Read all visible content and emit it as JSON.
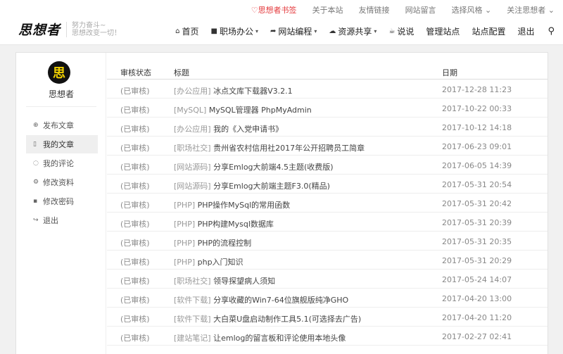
{
  "topbar": [
    {
      "label": "思想者书签",
      "icon": "heart-icon",
      "highlight": true
    },
    {
      "label": "关于本站"
    },
    {
      "label": "友情链接"
    },
    {
      "label": "网站留言"
    },
    {
      "label": "选择风格",
      "dropdown": true
    },
    {
      "label": "关注思想者",
      "dropdown": true
    }
  ],
  "logo": {
    "text": "思想者",
    "slogan1": "努力奋斗~",
    "slogan2": "思想改变一切！"
  },
  "nav": [
    {
      "label": "首页",
      "icon": "home-icon"
    },
    {
      "label": "职场办公",
      "icon": "briefcase-icon",
      "dropdown": true
    },
    {
      "label": "网站编程",
      "icon": "share-icon",
      "dropdown": true
    },
    {
      "label": "资源共享",
      "icon": "cloud-download-icon",
      "dropdown": true
    },
    {
      "label": "说说",
      "icon": "coffee-icon"
    },
    {
      "label": "管理站点"
    },
    {
      "label": "站点配置"
    },
    {
      "label": "退出"
    }
  ],
  "sidebar": {
    "avatar_char": "思",
    "username": "思想者",
    "items": [
      {
        "label": "发布文章",
        "icon": "plus-circle-icon"
      },
      {
        "label": "我的文章",
        "icon": "file-icon",
        "active": true
      },
      {
        "label": "我的评论",
        "icon": "comment-icon"
      },
      {
        "label": "修改资料",
        "icon": "gear-icon"
      },
      {
        "label": "修改密码",
        "icon": "unlock-icon"
      },
      {
        "label": "退出",
        "icon": "sign-out-icon"
      }
    ]
  },
  "table": {
    "headers": {
      "status": "审核状态",
      "title": "标题",
      "date": "日期"
    },
    "rows": [
      {
        "status": "(已审核)",
        "category": "[办公应用]",
        "title": "冰点文库下载器V3.2.1",
        "date": "2017-12-28 11:23"
      },
      {
        "status": "(已审核)",
        "category": "[MySQL]",
        "title": "MySQL管理器 PhpMyAdmin",
        "date": "2017-10-22 00:33"
      },
      {
        "status": "(已审核)",
        "category": "[办公应用]",
        "title": "我的《入党申请书》",
        "date": "2017-10-12 14:18"
      },
      {
        "status": "(已审核)",
        "category": "[职场社交]",
        "title": "贵州省农村信用社2017年公开招聘员工简章",
        "date": "2017-06-23 09:01"
      },
      {
        "status": "(已审核)",
        "category": "[网站源码]",
        "title": "分享Emlog大前端4.5主题(收费版)",
        "date": "2017-06-05 14:39"
      },
      {
        "status": "(已审核)",
        "category": "[网站源码]",
        "title": "分享Emlog大前端主题F3.0(精品)",
        "date": "2017-05-31 20:54"
      },
      {
        "status": "(已审核)",
        "category": "[PHP]",
        "title": "PHP操作MySql的常用函数",
        "date": "2017-05-31 20:42"
      },
      {
        "status": "(已审核)",
        "category": "[PHP]",
        "title": "PHP构建Mysql数据库",
        "date": "2017-05-31 20:39"
      },
      {
        "status": "(已审核)",
        "category": "[PHP]",
        "title": "PHP的流程控制",
        "date": "2017-05-31 20:35"
      },
      {
        "status": "(已审核)",
        "category": "[PHP]",
        "title": "php入门知识",
        "date": "2017-05-31 20:29"
      },
      {
        "status": "(已审核)",
        "category": "[职场社交]",
        "title": "领导探望病人须知",
        "date": "2017-05-24 14:07"
      },
      {
        "status": "(已审核)",
        "category": "[软件下载]",
        "title": "分享收藏的Win7-64位旗舰版纯净GHO",
        "date": "2017-04-20 13:00"
      },
      {
        "status": "(已审核)",
        "category": "[软件下载]",
        "title": "大白菜U盘启动制作工具5.1(可选择去广告)",
        "date": "2017-04-20 11:20"
      },
      {
        "status": "(已审核)",
        "category": "[建站笔记]",
        "title": "让emlog的留言板和评论使用本地头像",
        "date": "2017-02-27 02:41"
      }
    ]
  },
  "colors": {
    "highlight": "#e4393c",
    "page_bg": "#f1f1f1",
    "active_bg": "#efefef"
  }
}
